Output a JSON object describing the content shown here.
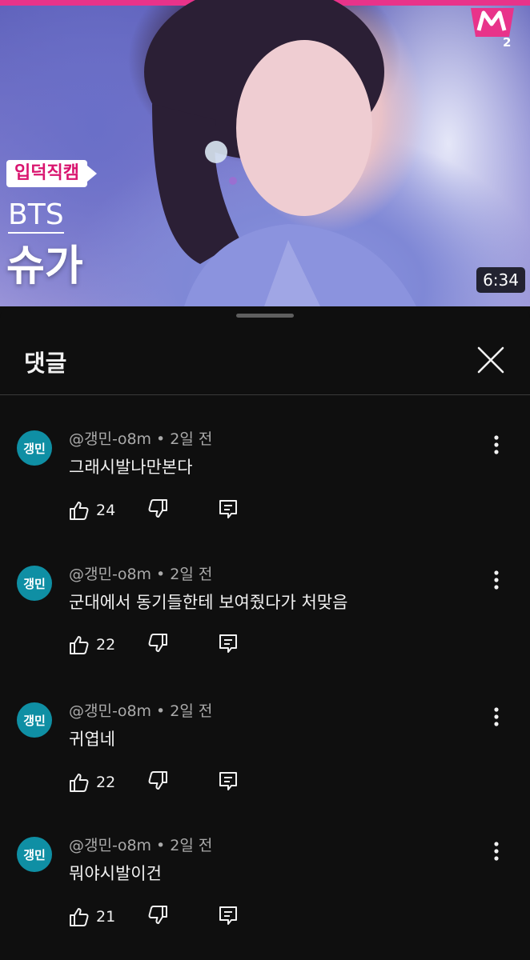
{
  "video": {
    "channel_logo": "M2",
    "fancam_badge": "입덕직캠",
    "artist": "BTS",
    "member": "슈가",
    "duration": "6:34"
  },
  "comments_sheet": {
    "title": "댓글",
    "close_icon": "close-icon"
  },
  "comments": [
    {
      "avatar": "갱민",
      "author": "@갱민-o8m",
      "time": "2일 전",
      "text": "그래시발나만본다",
      "likes": "24"
    },
    {
      "avatar": "갱민",
      "author": "@갱민-o8m",
      "time": "2일 전",
      "text": "군대에서 동기들한테 보여줬다가 처맞음",
      "likes": "22"
    },
    {
      "avatar": "갱민",
      "author": "@갱민-o8m",
      "time": "2일 전",
      "text": "귀엽네",
      "likes": "22"
    },
    {
      "avatar": "갱민",
      "author": "@갱민-o8m",
      "time": "2일 전",
      "text": "뭐야시발이건",
      "likes": "21"
    }
  ],
  "colors": {
    "background": "#0f0f0f",
    "avatar": "#0f8fa4",
    "accent_pink": "#e8338a"
  }
}
